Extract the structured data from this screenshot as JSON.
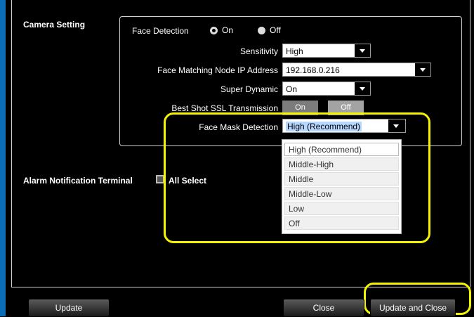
{
  "camera_setting": {
    "title": "Camera Setting",
    "face_detection": {
      "label": "Face Detection",
      "on": "On",
      "off": "Off",
      "selected": "On"
    },
    "sensitivity": {
      "label": "Sensitivity",
      "value": "High"
    },
    "node_ip": {
      "label": "Face Matching Node IP Address",
      "value": "192.168.0.216"
    },
    "super_dynamic": {
      "label": "Super Dynamic",
      "value": "On"
    },
    "ssl": {
      "label": "Best Shot SSL Transmission",
      "on": "On",
      "off": "Off"
    },
    "mask": {
      "label": "Face Mask Detection",
      "value": "High (Recommend)",
      "options": [
        "High (Recommend)",
        "Middle-High",
        "Middle",
        "Middle-Low",
        "Low",
        "Off"
      ]
    }
  },
  "alarm": {
    "label": "Alarm Notification Terminal",
    "select_all": "All Select"
  },
  "buttons": {
    "update": "Update",
    "close": "Close",
    "update_close": "Update and Close"
  },
  "colors": {
    "highlight": "#f4f400",
    "frame_blue": "#0b6fb8"
  }
}
